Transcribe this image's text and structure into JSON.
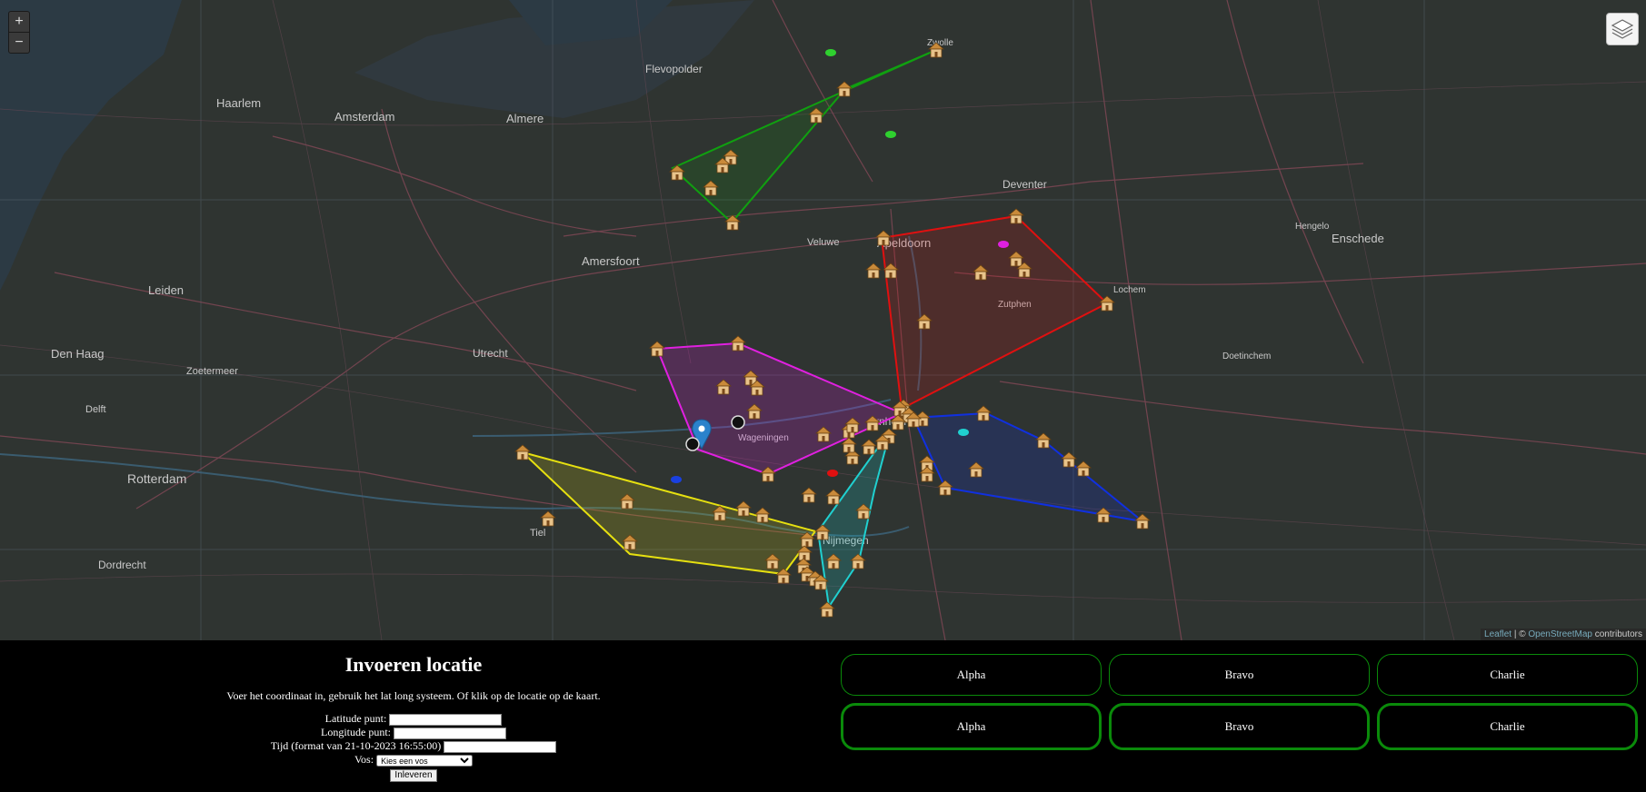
{
  "map": {
    "zoom_in": "+",
    "zoom_out": "−",
    "attribution_prefix": "Leaflet",
    "attribution_sep": " | © ",
    "attribution_link": "OpenStreetMap",
    "attribution_suffix": " contributors",
    "labels": [
      {
        "text": "Haarlem"
      },
      {
        "text": "Amsterdam"
      },
      {
        "text": "Almere"
      },
      {
        "text": "Flevopolder"
      },
      {
        "text": "Leiden"
      },
      {
        "text": "Den Haag"
      },
      {
        "text": "Zoetermeer"
      },
      {
        "text": "Delft"
      },
      {
        "text": "Rotterdam"
      },
      {
        "text": "Dordrecht"
      },
      {
        "text": "Utrecht"
      },
      {
        "text": "Amersfoort"
      },
      {
        "text": "Apeldoorn"
      },
      {
        "text": "Deventer"
      },
      {
        "text": "Enschede"
      },
      {
        "text": "Hengelo"
      },
      {
        "text": "Arnhem"
      },
      {
        "text": "Nijmegen"
      },
      {
        "text": "Tiel"
      },
      {
        "text": "Veluwe"
      },
      {
        "text": "Wageningen"
      },
      {
        "text": "Zwolle"
      },
      {
        "text": "Lochem"
      },
      {
        "text": "Zutphen"
      },
      {
        "text": "Doetinchem"
      }
    ],
    "areas": [
      {
        "name": "green",
        "color": "#10a010"
      },
      {
        "name": "red",
        "color": "#e01010"
      },
      {
        "name": "magenta",
        "color": "#e020e0"
      },
      {
        "name": "yellow",
        "color": "#e6e010"
      },
      {
        "name": "cyan",
        "color": "#20d0d0"
      },
      {
        "name": "blue",
        "color": "#1030e0"
      }
    ]
  },
  "form": {
    "title": "Invoeren locatie",
    "description": "Voer het coordinaat in, gebruik het lat long systeem. Of klik op de locatie op de kaart.",
    "lat_label": "Latitude punt:",
    "lat_value": "",
    "lon_label": "Longitude punt:",
    "lon_value": "",
    "time_label": "Tijd (format van 21-10-2023 16:55:00)",
    "time_value": "",
    "vos_label": "Vos:",
    "vos_selected": "Kies een vos",
    "submit_label": "Inleveren"
  },
  "teams_row1": [
    "Alpha",
    "Bravo",
    "Charlie"
  ],
  "teams_row2": [
    "Alpha",
    "Bravo",
    "Charlie"
  ],
  "colors": {
    "team_border": "#0a8a0a",
    "background": "#000000",
    "map_bg": "#2f3431"
  }
}
